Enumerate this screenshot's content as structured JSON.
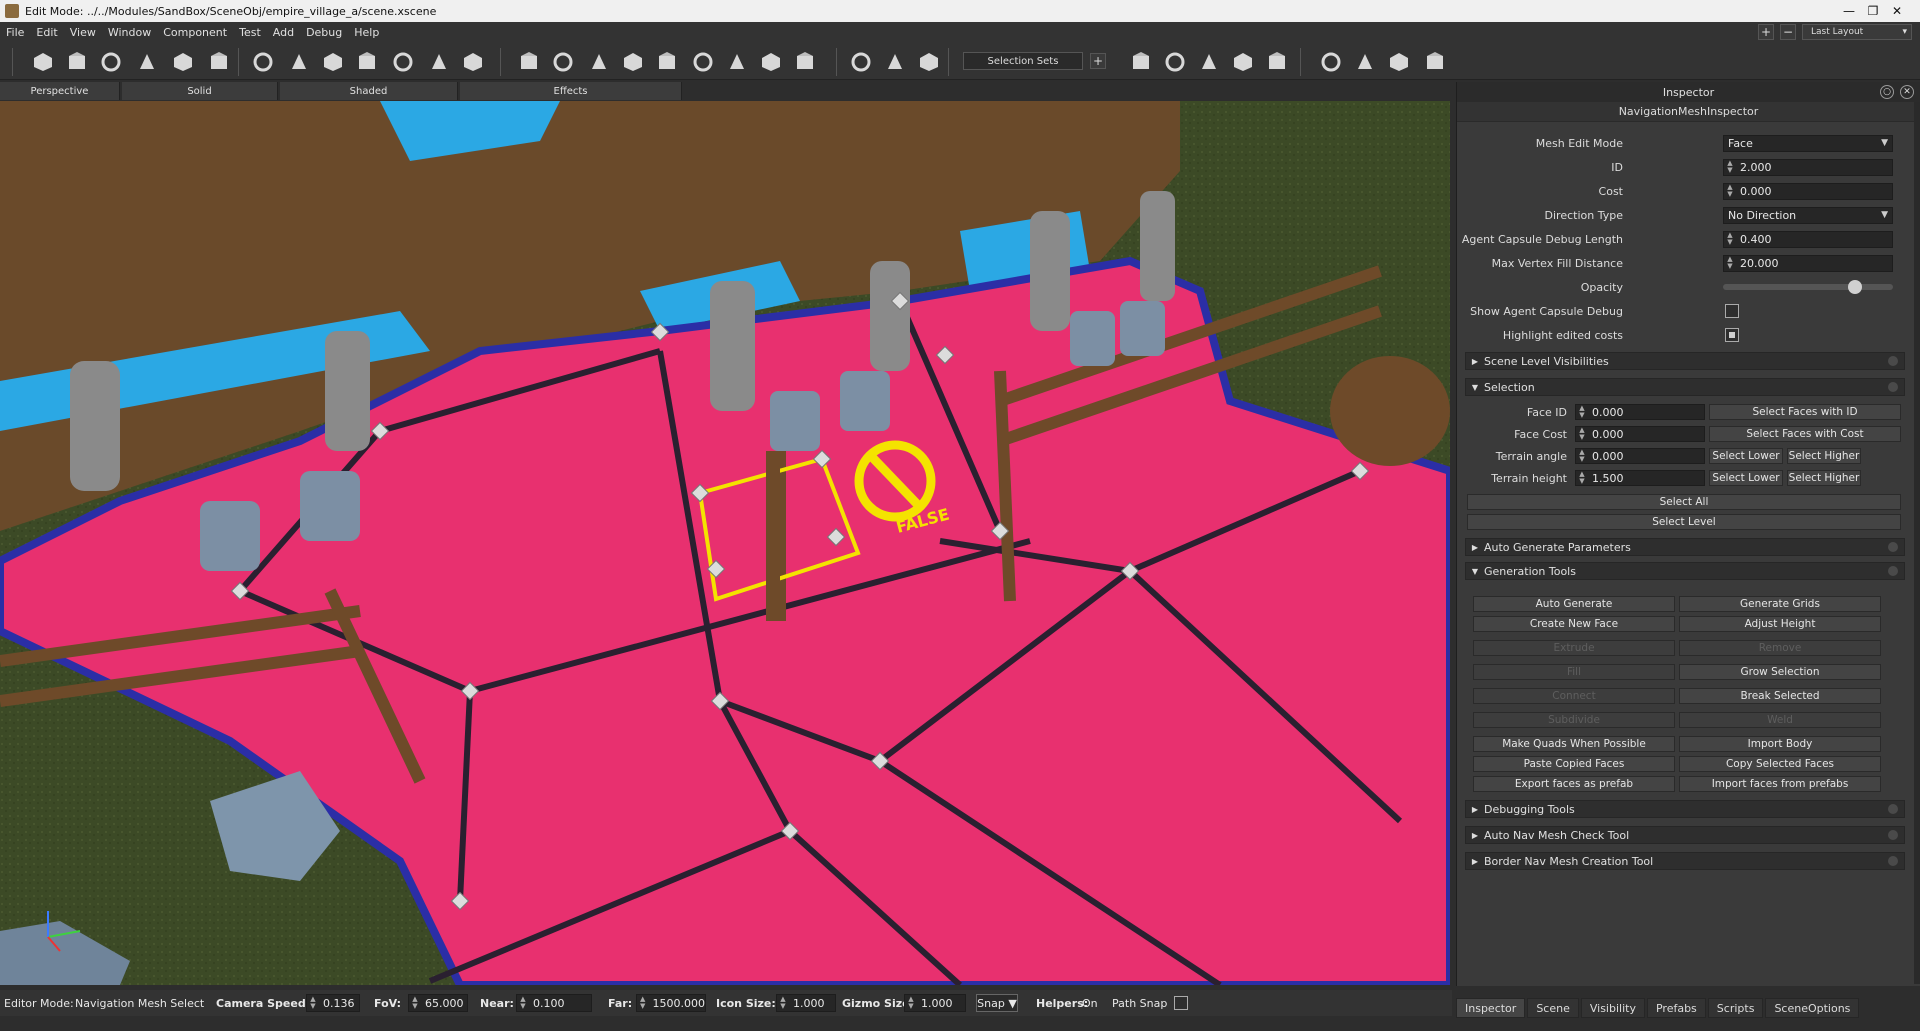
{
  "window": {
    "title": "Edit Mode: ../../Modules/SandBox/SceneObj/empire_village_a/scene.xscene",
    "minimize": "—",
    "restore": "❐",
    "close": "✕"
  },
  "menu": [
    "File",
    "Edit",
    "View",
    "Window",
    "Component",
    "Test",
    "Add",
    "Debug",
    "Help"
  ],
  "layout": {
    "plus": "+",
    "minus": "−",
    "selected": "Last Layout"
  },
  "toolbar": {
    "selection_sets": "Selection Sets",
    "add": "+",
    "icons": [
      "hand-icon",
      "save-icon",
      "open-icon",
      "play-icon",
      "play-outline-icon",
      "build-icon",
      "house-icon",
      "house-alt-icon",
      "house-variant-icon",
      "atom-icon",
      "tree-icon",
      "ag-text-icon",
      "path-icon",
      "cube-icon",
      "cube-add-icon",
      "cube-cut-icon",
      "cube-alt-icon",
      "buildings-icon",
      "splash-icon",
      "cube-wire-icon",
      "cube-doors-icon",
      "cube-nav-icon",
      "snap-icon",
      "axis-icon",
      "axis-alt-icon",
      "binoculars-icon",
      "weather-icon",
      "hand-alt-icon",
      "sphere-icon",
      "gi-icon",
      "cube-light-icon",
      "ruler-icon",
      "warning-icon",
      "sound-icon"
    ]
  },
  "view_tabs": [
    "Perspective",
    "Solid",
    "Shaded",
    "Effects"
  ],
  "viewport": {
    "overlay_label": "FALSE",
    "colors": {
      "navmesh": "#e8306f",
      "navmesh_border": "#2b2ea6",
      "wood": "#6e4a29",
      "wall": "#6a4a2a",
      "grass": "#3d4726",
      "highlight": "#f4e300",
      "blue": "#2ba8e4"
    }
  },
  "inspector": {
    "title": "Inspector",
    "subtitle": "NavigationMeshInspector",
    "props": [
      {
        "label": "Mesh Edit Mode",
        "type": "dropdown",
        "value": "Face"
      },
      {
        "label": "ID",
        "type": "number",
        "value": "2.000"
      },
      {
        "label": "Cost",
        "type": "number",
        "value": "0.000"
      },
      {
        "label": "Direction Type",
        "type": "dropdown",
        "value": "No Direction"
      },
      {
        "label": "Agent Capsule Debug Length",
        "type": "number",
        "value": "0.400"
      },
      {
        "label": "Max Vertex Fill Distance",
        "type": "number",
        "value": "20.000"
      },
      {
        "label": "Opacity",
        "type": "slider",
        "value": 0.8
      },
      {
        "label": "Show Agent Capsule Debug",
        "type": "checkbox",
        "checked": false
      },
      {
        "label": "Highlight edited costs",
        "type": "checkbox",
        "checked": true
      }
    ],
    "sections": {
      "scene_level": "Scene Level Visibilities",
      "selection": "Selection",
      "auto_gen": "Auto Generate Parameters",
      "gen_tools": "Generation Tools",
      "debugging": "Debugging Tools",
      "auto_check": "Auto Nav Mesh Check Tool",
      "border": "Border Nav Mesh Creation Tool"
    },
    "selection": {
      "rows": [
        {
          "label": "Face ID",
          "value": "0.000",
          "button": "Select Faces with ID"
        },
        {
          "label": "Face Cost",
          "value": "0.000",
          "button": "Select Faces with Cost"
        },
        {
          "label": "Terrain angle",
          "value": "0.000",
          "lower": "Select Lower",
          "higher": "Select Higher"
        },
        {
          "label": "Terrain height",
          "value": "1.500",
          "lower": "Select Lower",
          "higher": "Select Higher"
        }
      ],
      "select_all": "Select All",
      "select_level": "Select Level"
    },
    "gen_tools": [
      [
        "Auto Generate",
        "Generate Grids"
      ],
      [
        "Create New Face",
        "Adjust Height"
      ],
      [
        "Extrude",
        "Remove"
      ],
      [
        "Fill",
        "Grow Selection"
      ],
      [
        "Connect",
        "Break Selected"
      ],
      [
        "Subdivide",
        "Weld"
      ],
      [
        "Make Quads When Possible",
        "Import Body"
      ],
      [
        "Paste Copied Faces",
        "Copy Selected Faces"
      ],
      [
        "Export faces as prefab",
        "Import faces from prefabs"
      ]
    ],
    "gen_disabled": [
      "Extrude",
      "Remove",
      "Fill",
      "Connect",
      "Subdivide",
      "Weld"
    ]
  },
  "bottom_tabs": [
    "Inspector",
    "Scene",
    "Visibility",
    "Prefabs",
    "Scripts",
    "SceneOptions"
  ],
  "status": {
    "editor_mode_label": "Editor Mode:",
    "editor_mode_value": "Navigation Mesh Select",
    "camera_speed_label": "Camera Speed:",
    "camera_speed": "0.136",
    "fov_label": "FoV:",
    "fov": "65.000",
    "near_label": "Near:",
    "near": "0.100",
    "far_label": "Far:",
    "far": "1500.000",
    "icon_size_label": "Icon Size:",
    "icon_size": "1.000",
    "gizmo_size_label": "Gizmo Size",
    "gizmo_size": "1.000",
    "snap": "Snap",
    "helpers_label": "Helpers:",
    "helpers_value": "On",
    "path_snap": "Path Snap"
  }
}
